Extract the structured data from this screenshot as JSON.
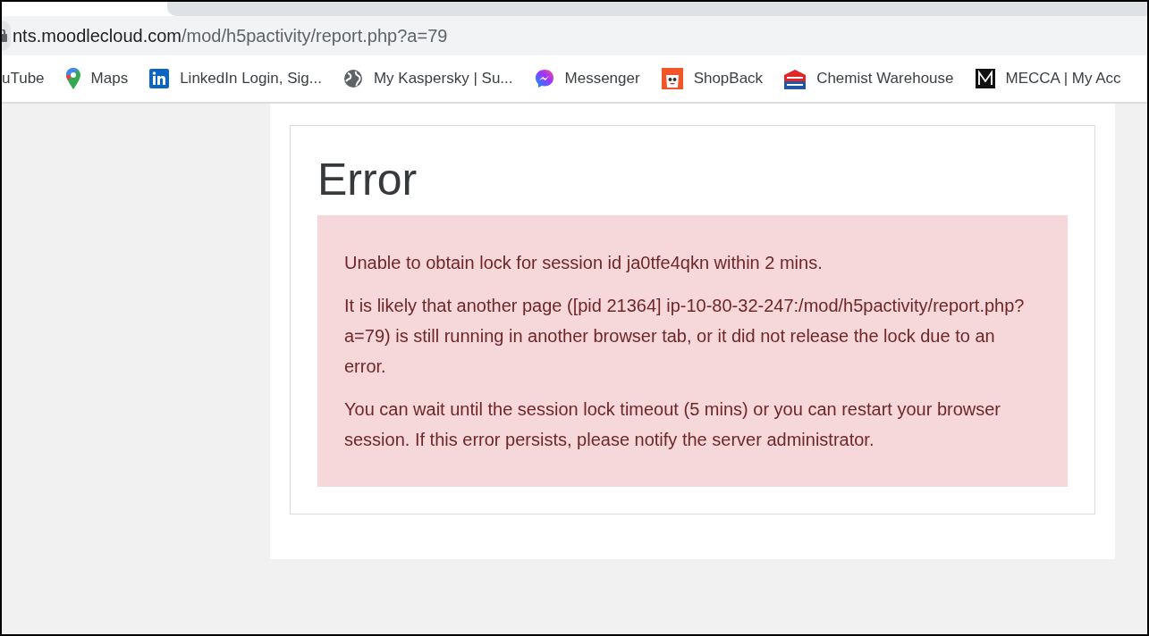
{
  "address_bar": {
    "host": "nts.moodlecloud.com",
    "path": "/mod/h5pactivity/report.php?a=79"
  },
  "bookmarks": [
    {
      "label": "uTube",
      "kind": "none"
    },
    {
      "label": "Maps",
      "kind": "pin"
    },
    {
      "label": "LinkedIn Login, Sig...",
      "kind": "in"
    },
    {
      "label": "My Kaspersky | Su...",
      "kind": "globe"
    },
    {
      "label": "Messenger",
      "kind": "chat"
    },
    {
      "label": "ShopBack",
      "kind": "bag"
    },
    {
      "label": "Chemist Warehouse",
      "kind": "store"
    },
    {
      "label": "MECCA | My Acc",
      "kind": "m"
    }
  ],
  "page": {
    "title": "Error",
    "messages": [
      "Unable to obtain lock for session id ja0tfe4qkn within 2 mins.",
      "It is likely that another page ([pid 21364] ip-10-80-32-247:/mod/h5pactivity/report.php?a=79) is still running in another browser tab, or it did not release the lock due to an error.",
      "You can wait until the session lock timeout (5 mins) or you can restart your browser session. If this error persists, please notify the server administrator."
    ]
  }
}
